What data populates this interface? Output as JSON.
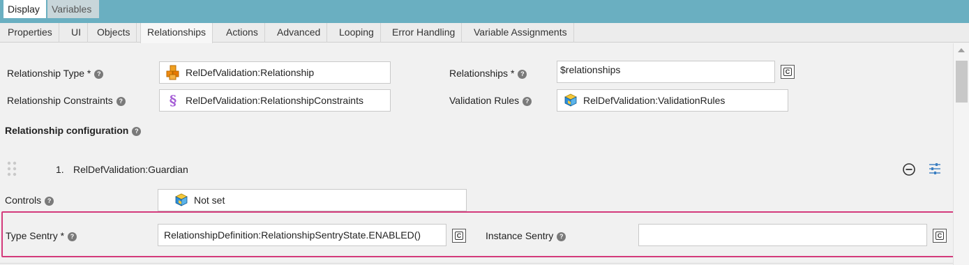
{
  "top_tabs": [
    "Display",
    "Variables"
  ],
  "tabs": [
    "Properties",
    "UI",
    "Objects",
    "Relationships",
    "Actions",
    "Advanced",
    "Looping",
    "Error Handling",
    "Variable Assignments"
  ],
  "active_tab": "Relationships",
  "form": {
    "relationship_type": {
      "label": "Relationship Type *",
      "value": "RelDefValidation:Relationship",
      "icon": "cubes-orange-icon"
    },
    "relationships": {
      "label": "Relationships *",
      "value": "$relationships"
    },
    "relationship_constraints": {
      "label": "Relationship Constraints",
      "value": "RelDefValidation:RelationshipConstraints",
      "icon": "section-purple-icon"
    },
    "validation_rules": {
      "label": "Validation Rules",
      "value": "RelDefValidation:ValidationRules",
      "icon": "cubes-blue-icon"
    }
  },
  "relationship_configuration": {
    "heading": "Relationship configuration",
    "item_number": "1.",
    "item_name": "RelDefValidation:Guardian",
    "controls_label": "Controls",
    "controls_value": "Not set",
    "type_sentry_label": "Type Sentry *",
    "type_sentry_value": "RelationshipDefinition:RelationshipSentryState.ENABLED()",
    "instance_sentry_label": "Instance Sentry",
    "instance_sentry_value": ""
  },
  "help_glyph": "?",
  "code_glyph": "C",
  "colors": {
    "topbar": "#6aafc1",
    "highlight": "#d33a7b",
    "accent": "#3a7ec1"
  }
}
